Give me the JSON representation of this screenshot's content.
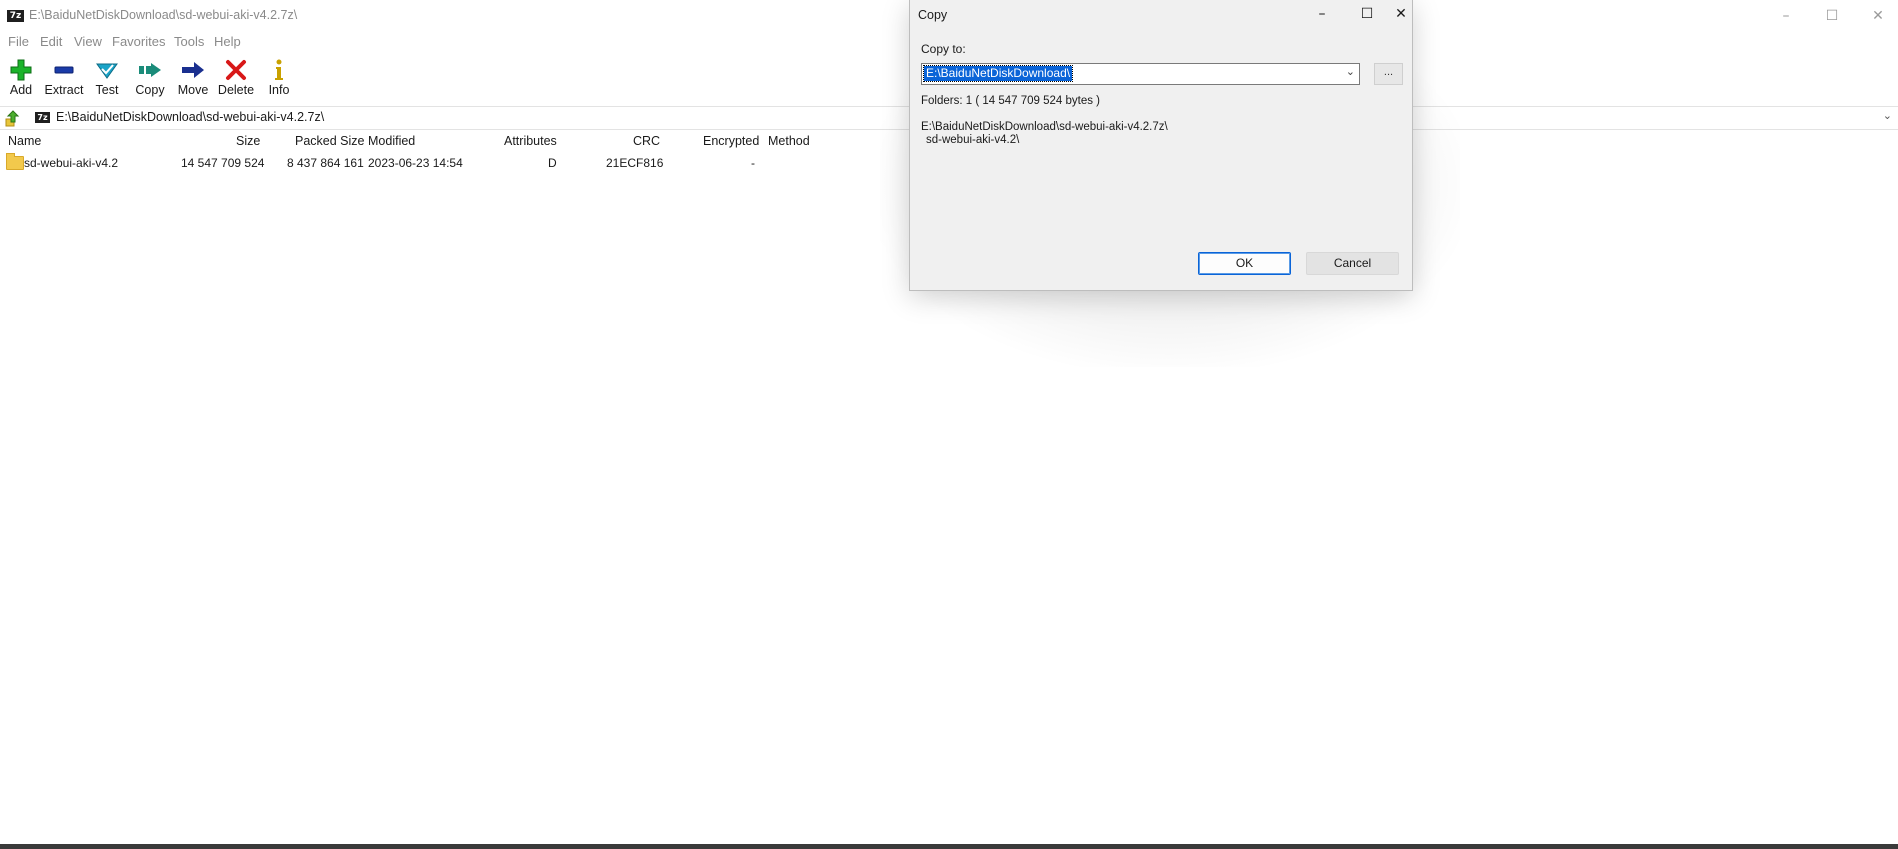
{
  "window": {
    "title": "E:\\BaiduNetDiskDownload\\sd-webui-aki-v4.2.7z\\",
    "app_icon": "7z",
    "controls": {
      "minimize": "–",
      "maximize": "☐",
      "close": "✕"
    }
  },
  "menu": [
    "File",
    "Edit",
    "View",
    "Favorites",
    "Tools",
    "Help"
  ],
  "toolbar": [
    {
      "label": "Add",
      "icon": "add-icon",
      "color": "#1bb32a"
    },
    {
      "label": "Extract",
      "icon": "extract-icon",
      "color": "#1a3ba8"
    },
    {
      "label": "Test",
      "icon": "test-icon",
      "color": "#1aa4c8"
    },
    {
      "label": "Copy",
      "icon": "copy-icon",
      "color": "#1b8c7a"
    },
    {
      "label": "Move",
      "icon": "move-icon",
      "color": "#1a2f8f"
    },
    {
      "label": "Delete",
      "icon": "delete-icon",
      "color": "#d81818"
    },
    {
      "label": "Info",
      "icon": "info-icon",
      "color": "#c9a100"
    }
  ],
  "address": {
    "icon": "7z",
    "path": "E:\\BaiduNetDiskDownload\\sd-webui-aki-v4.2.7z\\"
  },
  "columns": [
    "Name",
    "Size",
    "Packed Size",
    "Modified",
    "Attributes",
    "CRC",
    "Encrypted",
    "Method"
  ],
  "rows": [
    {
      "name": "sd-webui-aki-v4.2",
      "size": "14 547 709 524",
      "packed_size": "8 437 864 161",
      "modified": "2023-06-23 14:54",
      "attributes": "D",
      "crc": "21ECF816",
      "encrypted": "-",
      "method": ""
    }
  ],
  "dialog": {
    "title": "Copy",
    "controls": {
      "minimize": "–",
      "maximize": "☐",
      "close": "✕"
    },
    "copy_to_label": "Copy to:",
    "copy_to_value": "E:\\BaiduNetDiskDownload\\",
    "browse_label": "...",
    "info": "Folders: 1    ( 14 547 709 524 bytes )",
    "source_path": "E:\\BaiduNetDiskDownload\\sd-webui-aki-v4.2.7z\\",
    "source_item": "sd-webui-aki-v4.2\\",
    "ok_label": "OK",
    "cancel_label": "Cancel"
  }
}
